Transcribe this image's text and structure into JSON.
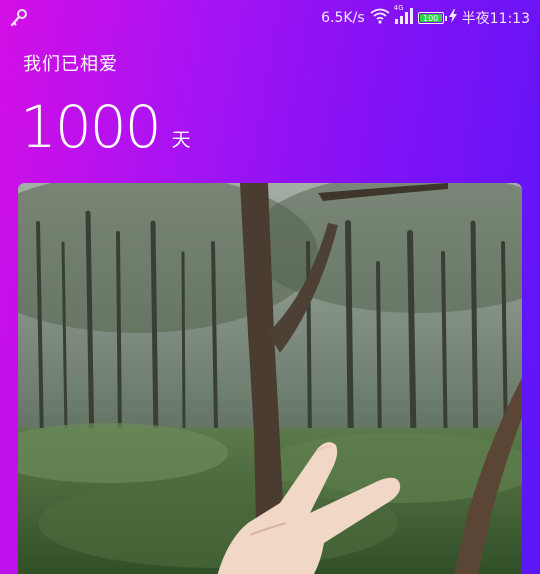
{
  "status_bar": {
    "left_icon": "key-icon",
    "speed": "6.5K/s",
    "wifi_icon": "wifi-icon",
    "network": "4G",
    "signal_icon": "signal-bars-icon",
    "battery_percent": "100",
    "charging_icon": "lightning-icon",
    "time": "半夜11:13"
  },
  "header": {
    "subtitle": "我们已相爱",
    "days_count": "1000",
    "days_unit": "天"
  },
  "photo": {
    "name": "forest-photo",
    "accent_colors": [
      "#d40fe6",
      "#5a16f7"
    ]
  }
}
